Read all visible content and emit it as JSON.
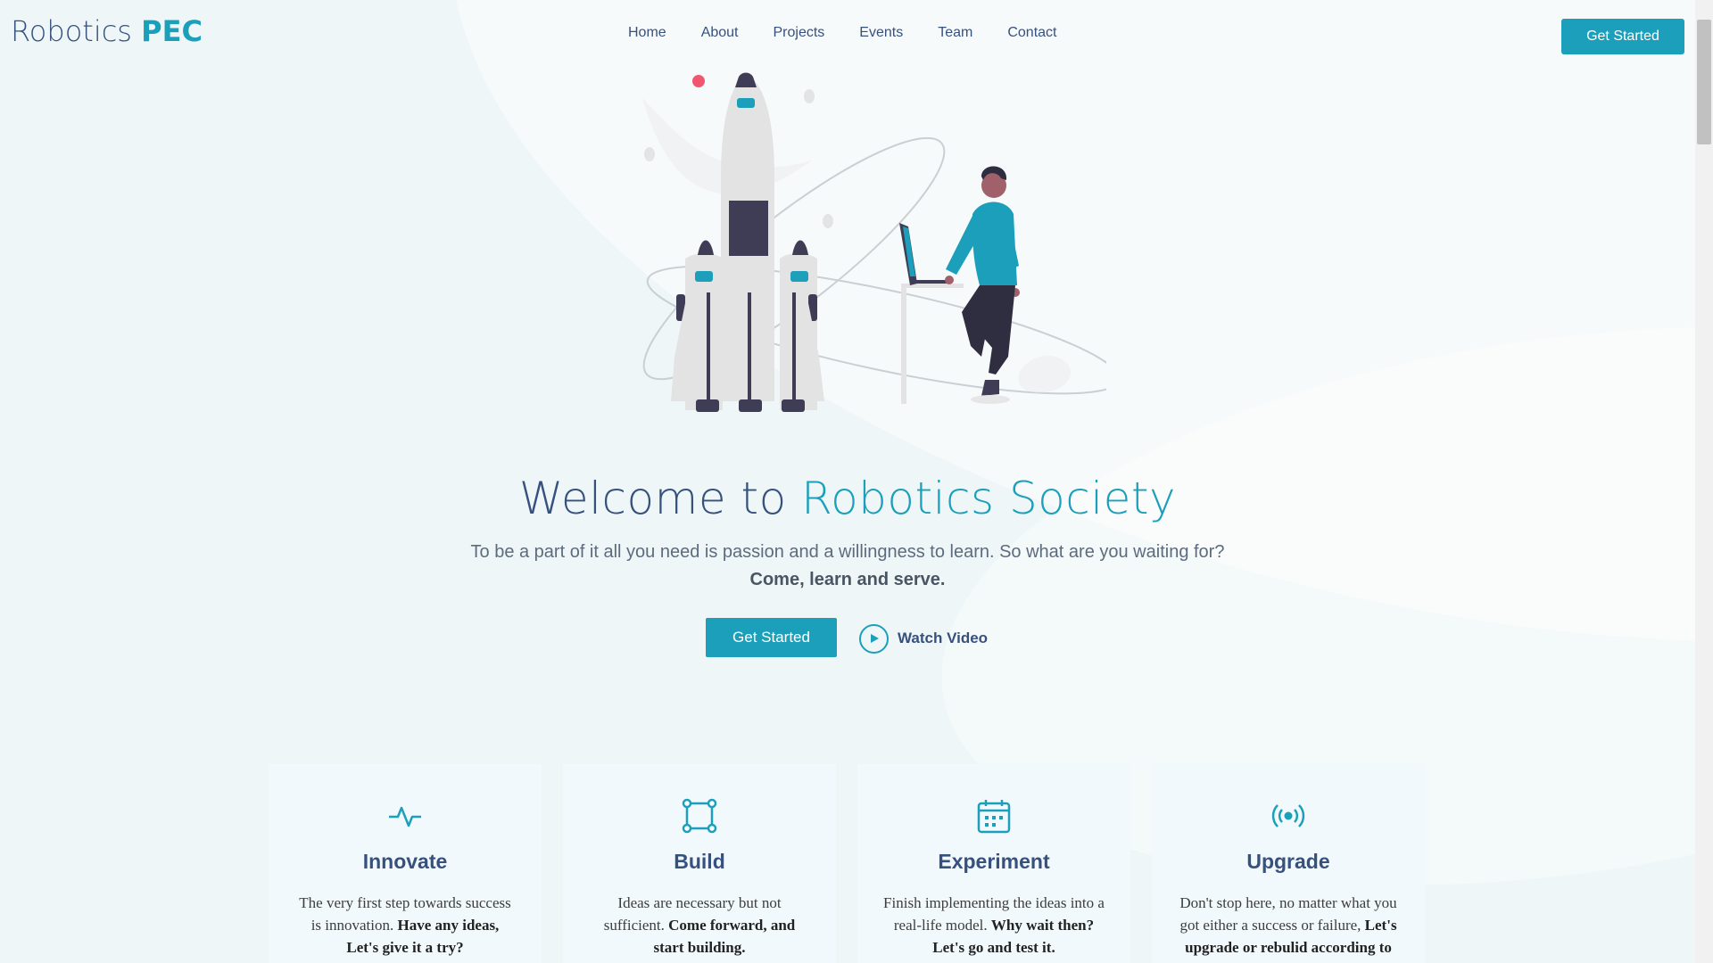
{
  "header": {
    "logo_main": "Robotics",
    "logo_accent": "PEC",
    "nav": [
      "Home",
      "About",
      "Projects",
      "Events",
      "Team",
      "Contact"
    ],
    "cta": "Get Started"
  },
  "hero": {
    "title_main": "Welcome to",
    "title_accent": "Robotics Society",
    "subtitle": "To be a part of it all you need is passion and a willingness to learn. So what are you waiting for?",
    "subtitle_bold": "Come, learn and serve.",
    "cta": "Get Started",
    "watch_label": "Watch Video"
  },
  "cards": [
    {
      "icon": "activity-icon",
      "title": "Innovate",
      "text": "The very first step towards success is innovation.",
      "bold": "Have any ideas, Let's give it a try?"
    },
    {
      "icon": "vector-square-icon",
      "title": "Build",
      "text": "Ideas are necessary but not sufficient.",
      "bold": "Come forward, and start building."
    },
    {
      "icon": "calendar-icon",
      "title": "Experiment",
      "text": "Finish implementing the ideas into a real-life model.",
      "bold": "Why wait then? Let's go and test it."
    },
    {
      "icon": "broadcast-icon",
      "title": "Upgrade",
      "text": "Don't stop here, no matter what you got either a success or failure,",
      "bold": "Let's upgrade or rebulid according to the result"
    }
  ],
  "colors": {
    "accent": "#1b9fba",
    "heading": "#37517e",
    "card_bg": "#f1f9fc"
  }
}
